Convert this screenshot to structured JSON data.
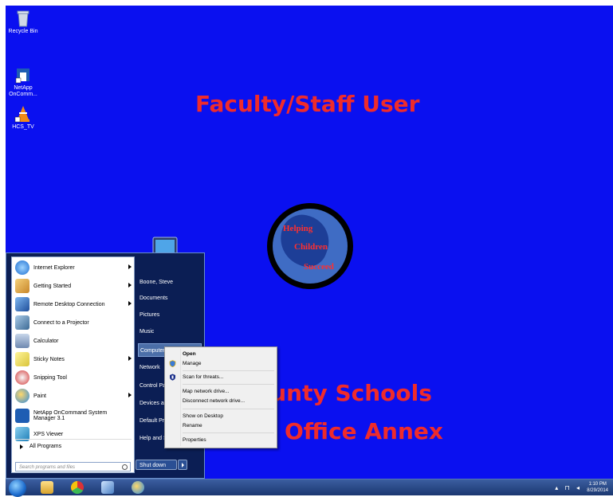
{
  "desktop": {
    "icons": [
      {
        "label": "Recycle Bin",
        "icon": "recycle-bin-icon"
      },
      {
        "label": "NetApp OnComm...",
        "icon": "netapp-icon"
      },
      {
        "label": "HCS_TV",
        "icon": "vlc-icon"
      }
    ],
    "wallpaper": {
      "title": "Faculty/Staff User",
      "line1": "ounty Schools",
      "line2": "Office Annex",
      "motto": [
        "Helping",
        "Children",
        "Succeed"
      ],
      "text_color": "#ef2b2b",
      "background": "#0a10f0"
    }
  },
  "start_menu": {
    "programs": [
      {
        "label": "Internet Explorer",
        "icon": "internet-explorer-icon",
        "submenu": true
      },
      {
        "label": "Getting Started",
        "icon": "getting-started-icon",
        "submenu": true
      },
      {
        "label": "Remote Desktop Connection",
        "icon": "remote-desktop-icon",
        "submenu": true
      },
      {
        "label": "Connect to a Projector",
        "icon": "projector-icon",
        "submenu": false
      },
      {
        "label": "Calculator",
        "icon": "calculator-icon",
        "submenu": false
      },
      {
        "label": "Sticky Notes",
        "icon": "sticky-notes-icon",
        "submenu": true
      },
      {
        "label": "Snipping Tool",
        "icon": "snipping-tool-icon",
        "submenu": false
      },
      {
        "label": "Paint",
        "icon": "paint-icon",
        "submenu": true
      },
      {
        "label": "NetApp OnCommand System Manager 3.1",
        "icon": "netapp-icon",
        "submenu": false
      },
      {
        "label": "XPS Viewer",
        "icon": "xps-viewer-icon",
        "submenu": false
      }
    ],
    "all_programs": "All Programs",
    "search_placeholder": "Search programs and files",
    "right_items": [
      "Boone, Steve",
      "Documents",
      "Pictures",
      "Music",
      "Computer",
      "Network",
      "Control Pa",
      "Devices an",
      "Default Pro",
      "Help and S"
    ],
    "highlighted_item": "Computer",
    "shutdown_label": "Shut down"
  },
  "context_menu": {
    "items": [
      {
        "label": "Open",
        "bold": true
      },
      {
        "label": "Manage",
        "icon": "shield-icon"
      },
      {
        "label": "Scan for threats...",
        "icon": "antivirus-icon"
      },
      {
        "label": "Map network drive..."
      },
      {
        "label": "Disconnect network drive..."
      },
      {
        "label": "Show on Desktop"
      },
      {
        "label": "Rename"
      },
      {
        "label": "Properties"
      }
    ]
  },
  "taskbar": {
    "pinned": [
      "start-orb-icon",
      "explorer-icon",
      "chrome-icon",
      "network-connect-icon",
      "paint-icon"
    ],
    "clock_time": "1:10 PM",
    "clock_date": "8/29/2014"
  }
}
